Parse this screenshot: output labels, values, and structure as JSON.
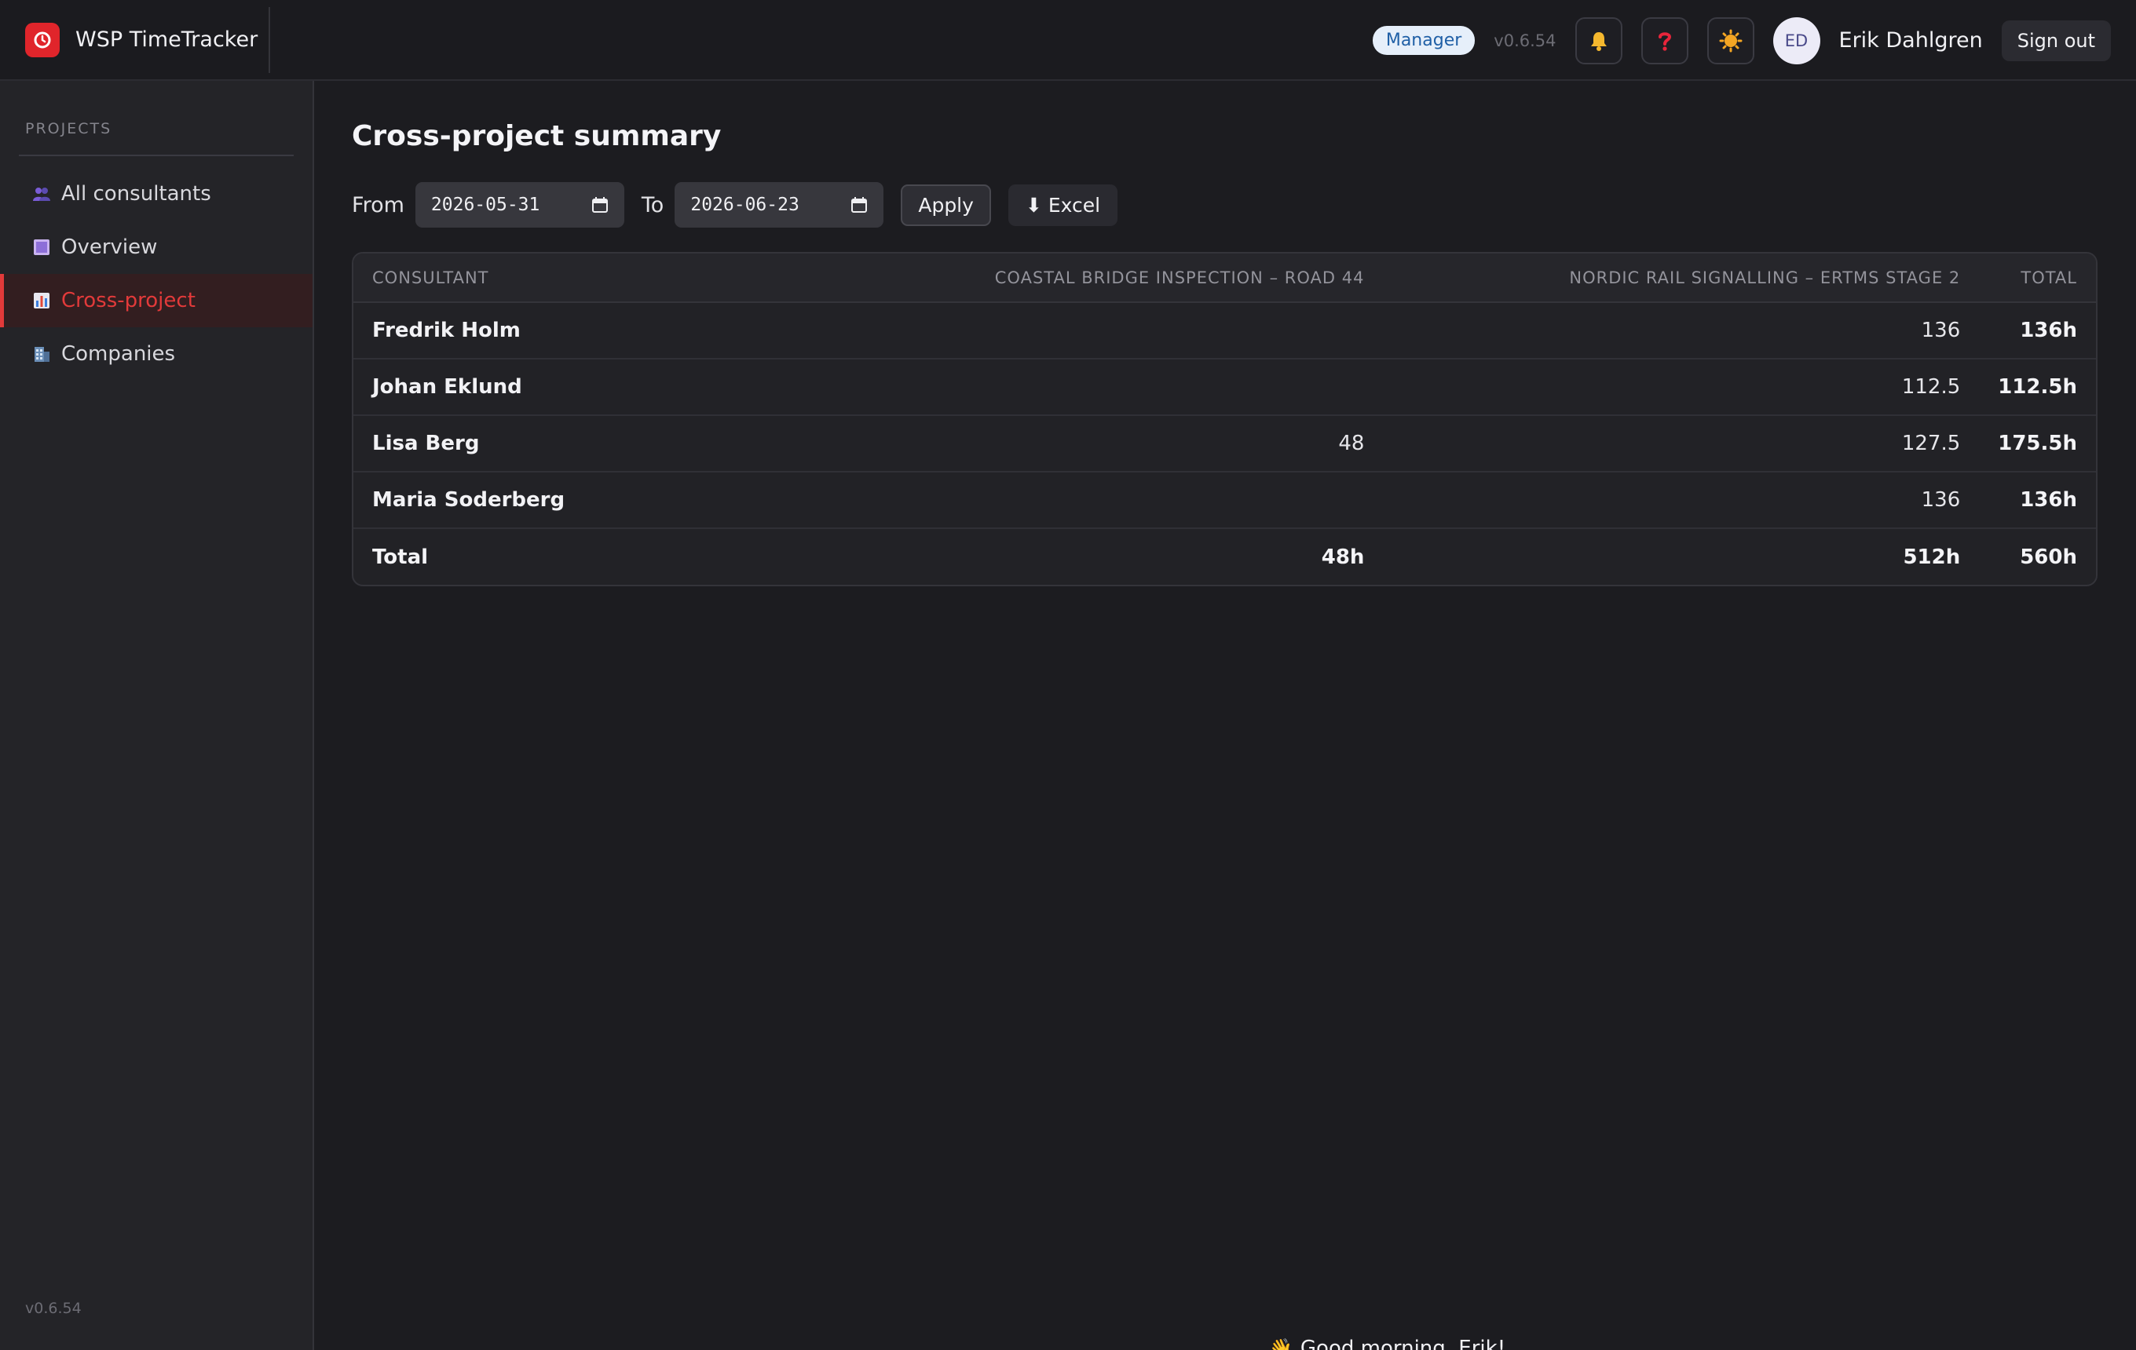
{
  "app": {
    "name": "WSP TimeTracker",
    "version": "v0.6.54"
  },
  "header": {
    "role_badge": "Manager",
    "version": "v0.6.54",
    "icons": [
      "bell-icon",
      "help-icon",
      "theme-toggle-icon"
    ],
    "avatar_initials": "ED",
    "user_name": "Erik Dahlgren",
    "sign_out_label": "Sign out"
  },
  "sidebar": {
    "heading": "PROJECTS",
    "items": [
      {
        "label": "All consultants",
        "icon": "people-icon",
        "active": false
      },
      {
        "label": "Overview",
        "icon": "square-icon",
        "active": false
      },
      {
        "label": "Cross-project",
        "icon": "bar-chart-icon",
        "active": true
      },
      {
        "label": "Companies",
        "icon": "building-icon",
        "active": false
      }
    ],
    "version": "v0.6.54"
  },
  "main": {
    "title": "Cross-project summary",
    "filters": {
      "from_label": "From",
      "from_value": "2026-05-31",
      "to_label": "To",
      "to_value": "2026-06-23",
      "apply_label": "Apply",
      "excel_label": "⬇ Excel"
    },
    "table": {
      "columns": [
        "CONSULTANT",
        "COASTAL BRIDGE INSPECTION – ROAD 44",
        "NORDIC RAIL SIGNALLING – ERTMS STAGE 2",
        "TOTAL"
      ],
      "rows": [
        {
          "consultant": "Fredrik Holm",
          "coastal": "",
          "nordic": "136",
          "total": "136h"
        },
        {
          "consultant": "Johan Eklund",
          "coastal": "",
          "nordic": "112.5",
          "total": "112.5h"
        },
        {
          "consultant": "Lisa Berg",
          "coastal": "48",
          "nordic": "127.5",
          "total": "175.5h"
        },
        {
          "consultant": "Maria Soderberg",
          "coastal": "",
          "nordic": "136",
          "total": "136h"
        }
      ],
      "totals": {
        "label": "Total",
        "coastal": "48h",
        "nordic": "512h",
        "total": "560h"
      }
    }
  },
  "toast": {
    "emoji": "👋",
    "text": "Good morning, Erik!"
  },
  "colors": {
    "accent": "#e23a3a",
    "background": "#1c1c20",
    "sidebar": "#242428"
  }
}
